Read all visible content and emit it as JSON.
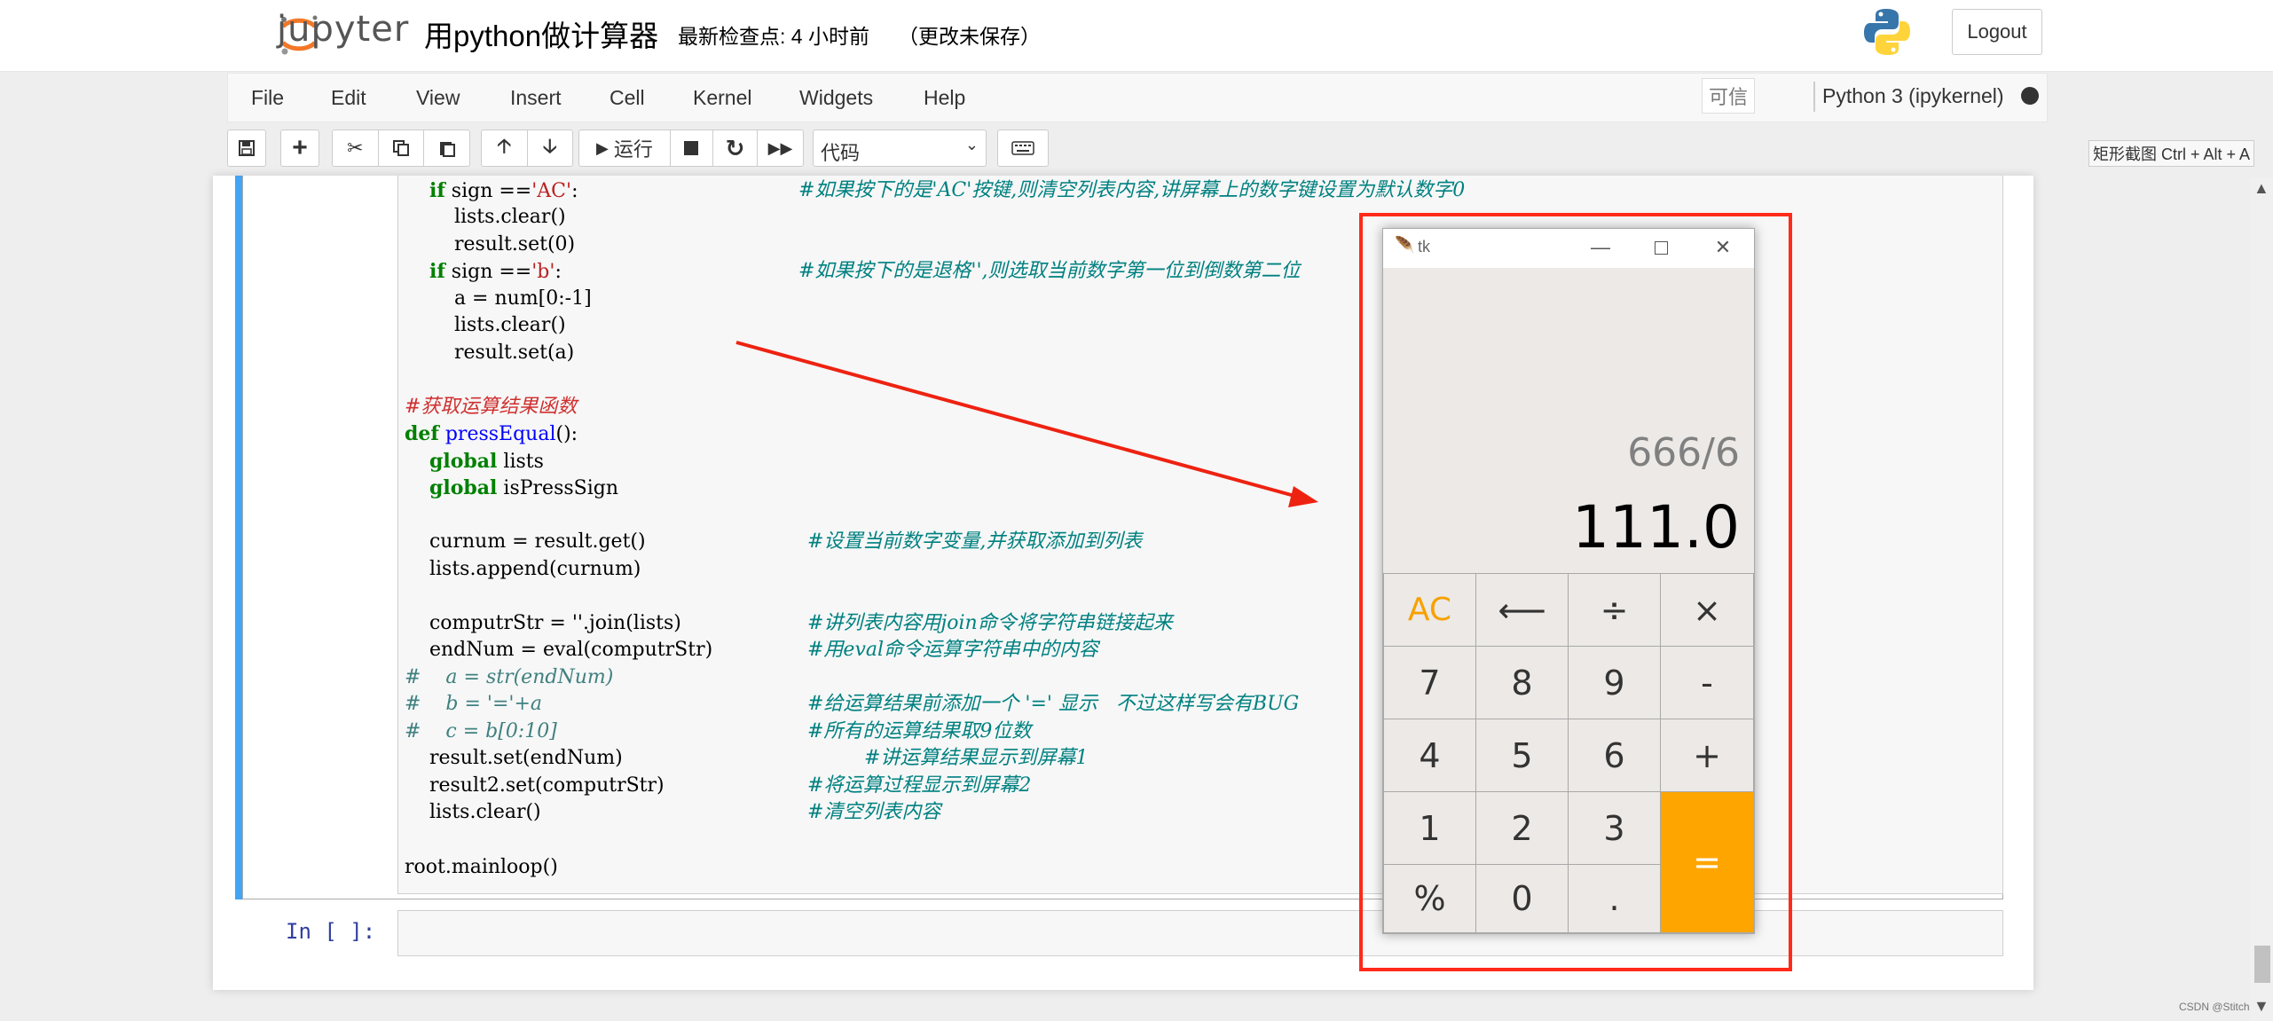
{
  "header": {
    "logo_text": "jupyter",
    "notebook_title": "用python做计算器",
    "checkpoint": "最新检查点: 4 小时前",
    "unsaved": "（更改未保存）",
    "logout_label": "Logout"
  },
  "menubar": {
    "items": [
      "File",
      "Edit",
      "View",
      "Insert",
      "Cell",
      "Kernel",
      "Widgets",
      "Help"
    ],
    "trusted_label": "可信",
    "kernel_name": "Python 3 (ipykernel)"
  },
  "toolbar": {
    "run_label": "运行",
    "cell_type": "代码",
    "snip_hint": "矩形截图 Ctrl + Alt + A"
  },
  "code_lines": [
    {
      "indent": "    ",
      "kw": "if",
      "text": " sign ==",
      "str": "'AC'",
      "rest": ":",
      "comment": "#如果按下的是'AC'按键,则清空列表内容,讲屏幕上的数字键设置为默认数字0"
    },
    {
      "code": "        lists.clear()"
    },
    {
      "code": "        result.set(0)"
    },
    {
      "indent": "    ",
      "kw": "if",
      "text": " sign ==",
      "str": "'b'",
      "rest": ":",
      "comment": "#如果按下的是退格'',则选取当前数字第一位到倒数第二位"
    },
    {
      "code": "        a = num[0:-1]"
    },
    {
      "code": "        lists.clear()"
    },
    {
      "code": "        result.set(a)"
    },
    {
      "code": ""
    },
    {
      "red_comment": "#获取运算结果函数"
    },
    {
      "def_name": "pressEqual",
      "def_rest": "():"
    },
    {
      "global": "lists"
    },
    {
      "global": "isPressSign"
    },
    {
      "code": ""
    },
    {
      "code": "    curnum = result.get()",
      "comment": "#设置当前数字变量,并获取添加到列表"
    },
    {
      "code": "    lists.append(curnum)"
    },
    {
      "code": ""
    },
    {
      "code": "    computrStr = ''.join(lists)",
      "comment": "#讲列表内容用join命令将字符串链接起来"
    },
    {
      "code": "    endNum = eval(computrStr)",
      "comment": "#用eval命令运算字符串中的内容"
    },
    {
      "hash_code": "#    a = str(endNum)"
    },
    {
      "hash_code": "#    b = '='+a",
      "comment": "#给运算结果前添加一个 '=' 显示   不过这样写会有BUG"
    },
    {
      "hash_code": "#    c = b[0:10]",
      "comment": "#所有的运算结果取9位数"
    },
    {
      "code": "    result.set(endNum)",
      "comment2": "#讲运算结果显示到屏幕1"
    },
    {
      "code": "    result2.set(computrStr)",
      "comment": "#将运算过程显示到屏幕2"
    },
    {
      "code": "    lists.clear()",
      "comment": "#清空列表内容"
    },
    {
      "code": ""
    },
    {
      "code": "root.mainloop()"
    }
  ],
  "prompt": "In  [  ]:",
  "calculator": {
    "window_title": "tk",
    "expression": "666/6",
    "result": "111.0",
    "keys": [
      "AC",
      "⟵",
      "÷",
      "×",
      "7",
      "8",
      "9",
      "-",
      "4",
      "5",
      "6",
      "+",
      "1",
      "2",
      "3",
      "=",
      "%",
      "0",
      "."
    ],
    "accent_color": "#ffa500"
  },
  "watermark": "CSDN @Stitch"
}
